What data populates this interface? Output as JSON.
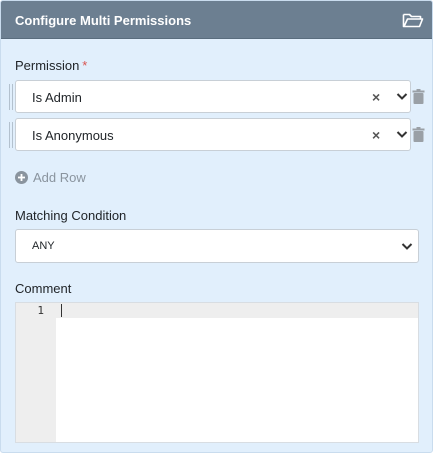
{
  "panel": {
    "title": "Configure Multi Permissions",
    "header_icon": "folder-open-icon"
  },
  "permission": {
    "label": "Permission",
    "required_marker": "*",
    "rows": [
      {
        "value": "Is Admin"
      },
      {
        "value": "Is Anonymous"
      }
    ],
    "clear_glyph": "×",
    "add_row_label": "Add Row"
  },
  "matching": {
    "label": "Matching Condition",
    "selected": "ANY"
  },
  "comment": {
    "label": "Comment",
    "line_numbers": [
      "1"
    ]
  },
  "colors": {
    "header_bg": "#6c7f91",
    "panel_bg": "#e1effc",
    "required": "#d9534f",
    "muted": "#8a949e"
  }
}
